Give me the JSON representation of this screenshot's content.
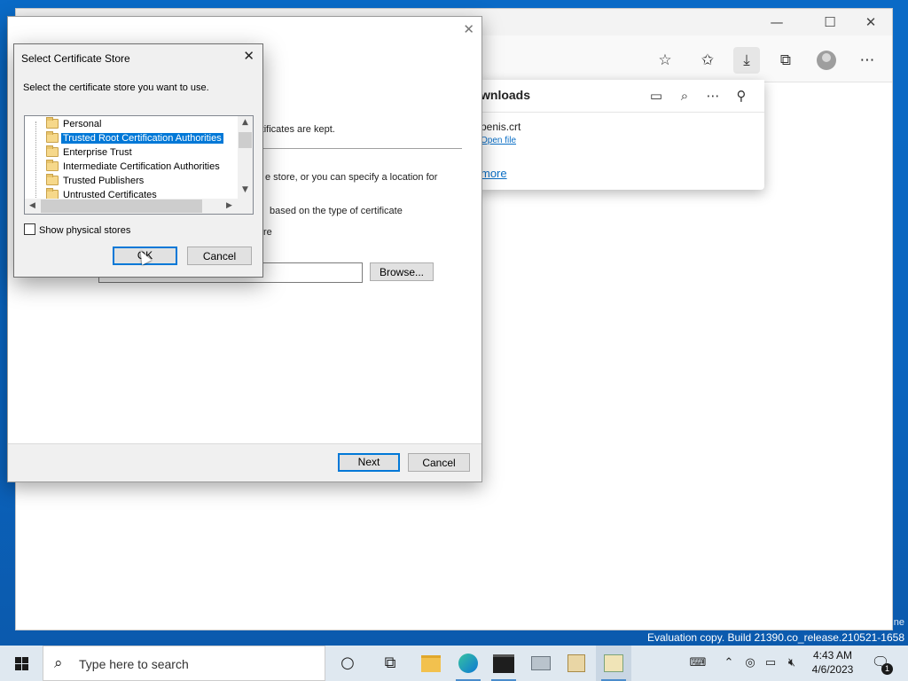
{
  "browser": {
    "window_controls": {
      "minimize": "—",
      "maximize": "☐",
      "close": "✕"
    },
    "downloads": {
      "title": "wnloads",
      "file_name": "penis.crt",
      "open_file": "Open file",
      "see_more": "more"
    }
  },
  "wizard": {
    "line1": "rtificates are kept.",
    "line2": "e store, or you can specify a location for",
    "line3": "based on the type of certificate",
    "line4": "re",
    "browse_label": "Browse...",
    "next_label": "Next",
    "cancel_label": "Cancel"
  },
  "dialog": {
    "title": "Select Certificate Store",
    "instruction": "Select the certificate store you want to use.",
    "stores": [
      {
        "label": "Personal",
        "selected": false
      },
      {
        "label": "Trusted Root Certification Authorities",
        "selected": true
      },
      {
        "label": "Enterprise Trust",
        "selected": false
      },
      {
        "label": "Intermediate Certification Authorities",
        "selected": false
      },
      {
        "label": "Trusted Publishers",
        "selected": false
      },
      {
        "label": "Untrusted Certificates",
        "selected": false
      }
    ],
    "show_physical_label": "Show physical stores",
    "show_physical_checked": false,
    "ok_label": "OK",
    "cancel_label": "Cancel"
  },
  "desktop": {
    "edge_text": "ne",
    "eval_text": "Evaluation copy. Build 21390.co_release.210521-1658"
  },
  "taskbar": {
    "search_placeholder": "Type here to search",
    "time": "4:43 AM",
    "date": "4/6/2023",
    "notification_count": "1"
  }
}
